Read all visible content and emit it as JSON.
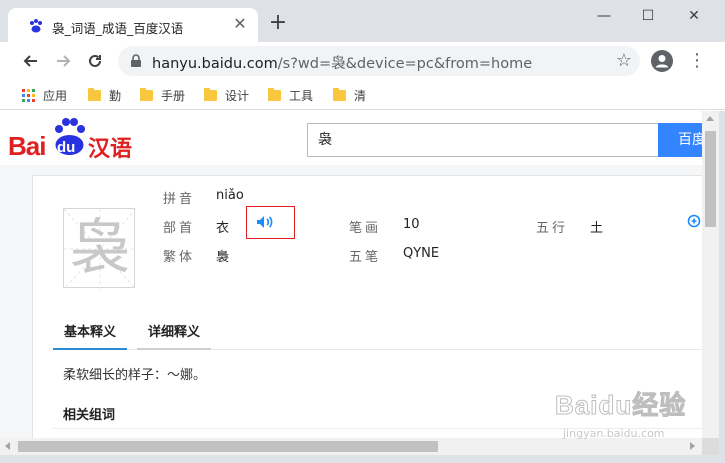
{
  "browser": {
    "tab_title": "袅_词语_成语_百度汉语",
    "tab_close": "✕",
    "new_tab": "+",
    "url_host": "hanyu.baidu.com",
    "url_path": "/s?wd=袅&device=pc&from=home",
    "window_controls": {
      "minimize": "—",
      "maximize": "☐",
      "close": "✕"
    },
    "bookmarks": [
      {
        "label": "应用",
        "icon": "apps-grid-icon"
      },
      {
        "label": "勤",
        "icon": "folder-icon"
      },
      {
        "label": "手册",
        "icon": "folder-icon"
      },
      {
        "label": "设计",
        "icon": "folder-icon"
      },
      {
        "label": "工具",
        "icon": "folder-icon"
      },
      {
        "label": "清",
        "icon": "folder-icon"
      }
    ]
  },
  "site": {
    "logo_bai": "Bai",
    "logo_du": "du",
    "logo_hanyu": "汉语",
    "search_value": "袅",
    "search_button": "百度"
  },
  "entry": {
    "character": "袅",
    "pinyin_label": "拼音",
    "pinyin_value": "niǎo",
    "radical_label": "部首",
    "radical_value": "衣",
    "traditional_label": "繁体",
    "traditional_value": "裊",
    "strokes_label": "笔画",
    "strokes_value": "10",
    "wubi_label": "五笔",
    "wubi_value": "QYNE",
    "wuxing_label": "五行",
    "wuxing_value": "土"
  },
  "tabs": [
    {
      "label": "基本释义",
      "active": true
    },
    {
      "label": "详细释义",
      "active": false
    }
  ],
  "definition": "柔软细长的样子：～娜。",
  "related_heading": "相关组词",
  "watermark": {
    "brand": "Baidu经验",
    "url": "jingyan.baidu.com"
  },
  "colors": {
    "baidu_red": "#e02020",
    "baidu_blue": "#2932e1",
    "search_blue": "#3385ff",
    "tab_active": "#2a8bd6"
  }
}
